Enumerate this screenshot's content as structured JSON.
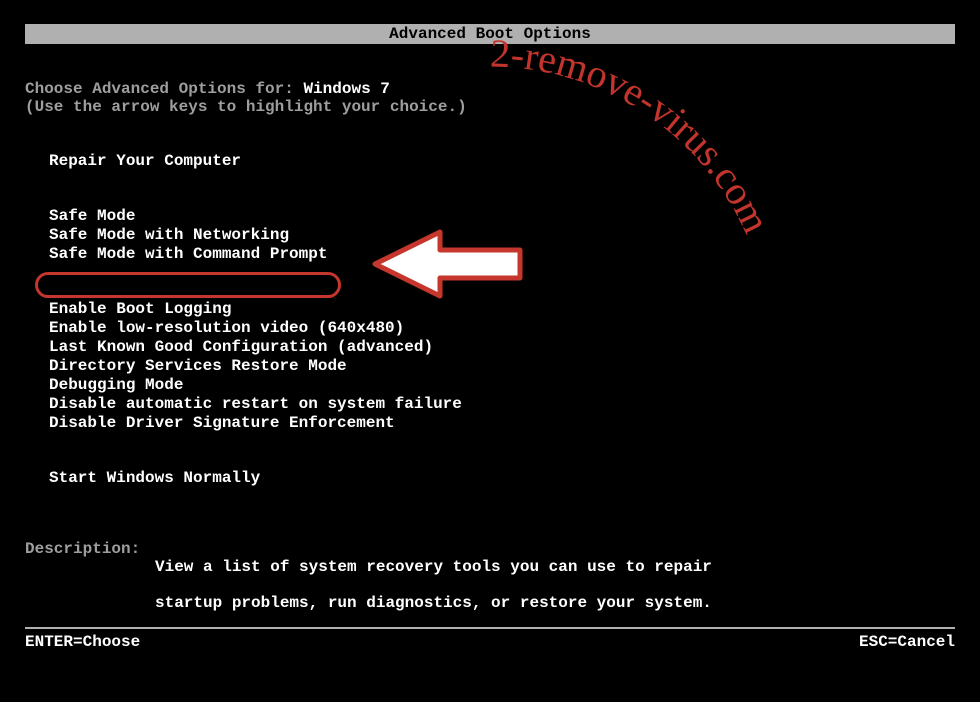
{
  "header": {
    "title": "Advanced Boot Options"
  },
  "intro": {
    "prefix": "Choose Advanced Options for: ",
    "os": "Windows 7",
    "hint": "(Use the arrow keys to highlight your choice.)"
  },
  "menu": {
    "group1": [
      "Repair Your Computer"
    ],
    "group2": [
      "Safe Mode",
      "Safe Mode with Networking",
      "Safe Mode with Command Prompt"
    ],
    "group3": [
      "Enable Boot Logging",
      "Enable low-resolution video (640x480)",
      "Last Known Good Configuration (advanced)",
      "Directory Services Restore Mode",
      "Debugging Mode",
      "Disable automatic restart on system failure",
      "Disable Driver Signature Enforcement"
    ],
    "group4": [
      "Start Windows Normally"
    ]
  },
  "highlighted": "Safe Mode with Command Prompt",
  "description": {
    "label": "Description:",
    "text_line1": "View a list of system recovery tools you can use to repair",
    "text_line2": "startup problems, run diagnostics, or restore your system."
  },
  "footer": {
    "left": "ENTER=Choose",
    "right": "ESC=Cancel"
  },
  "watermark": "2-remove-virus.com",
  "annotation_color": "#c5362d"
}
